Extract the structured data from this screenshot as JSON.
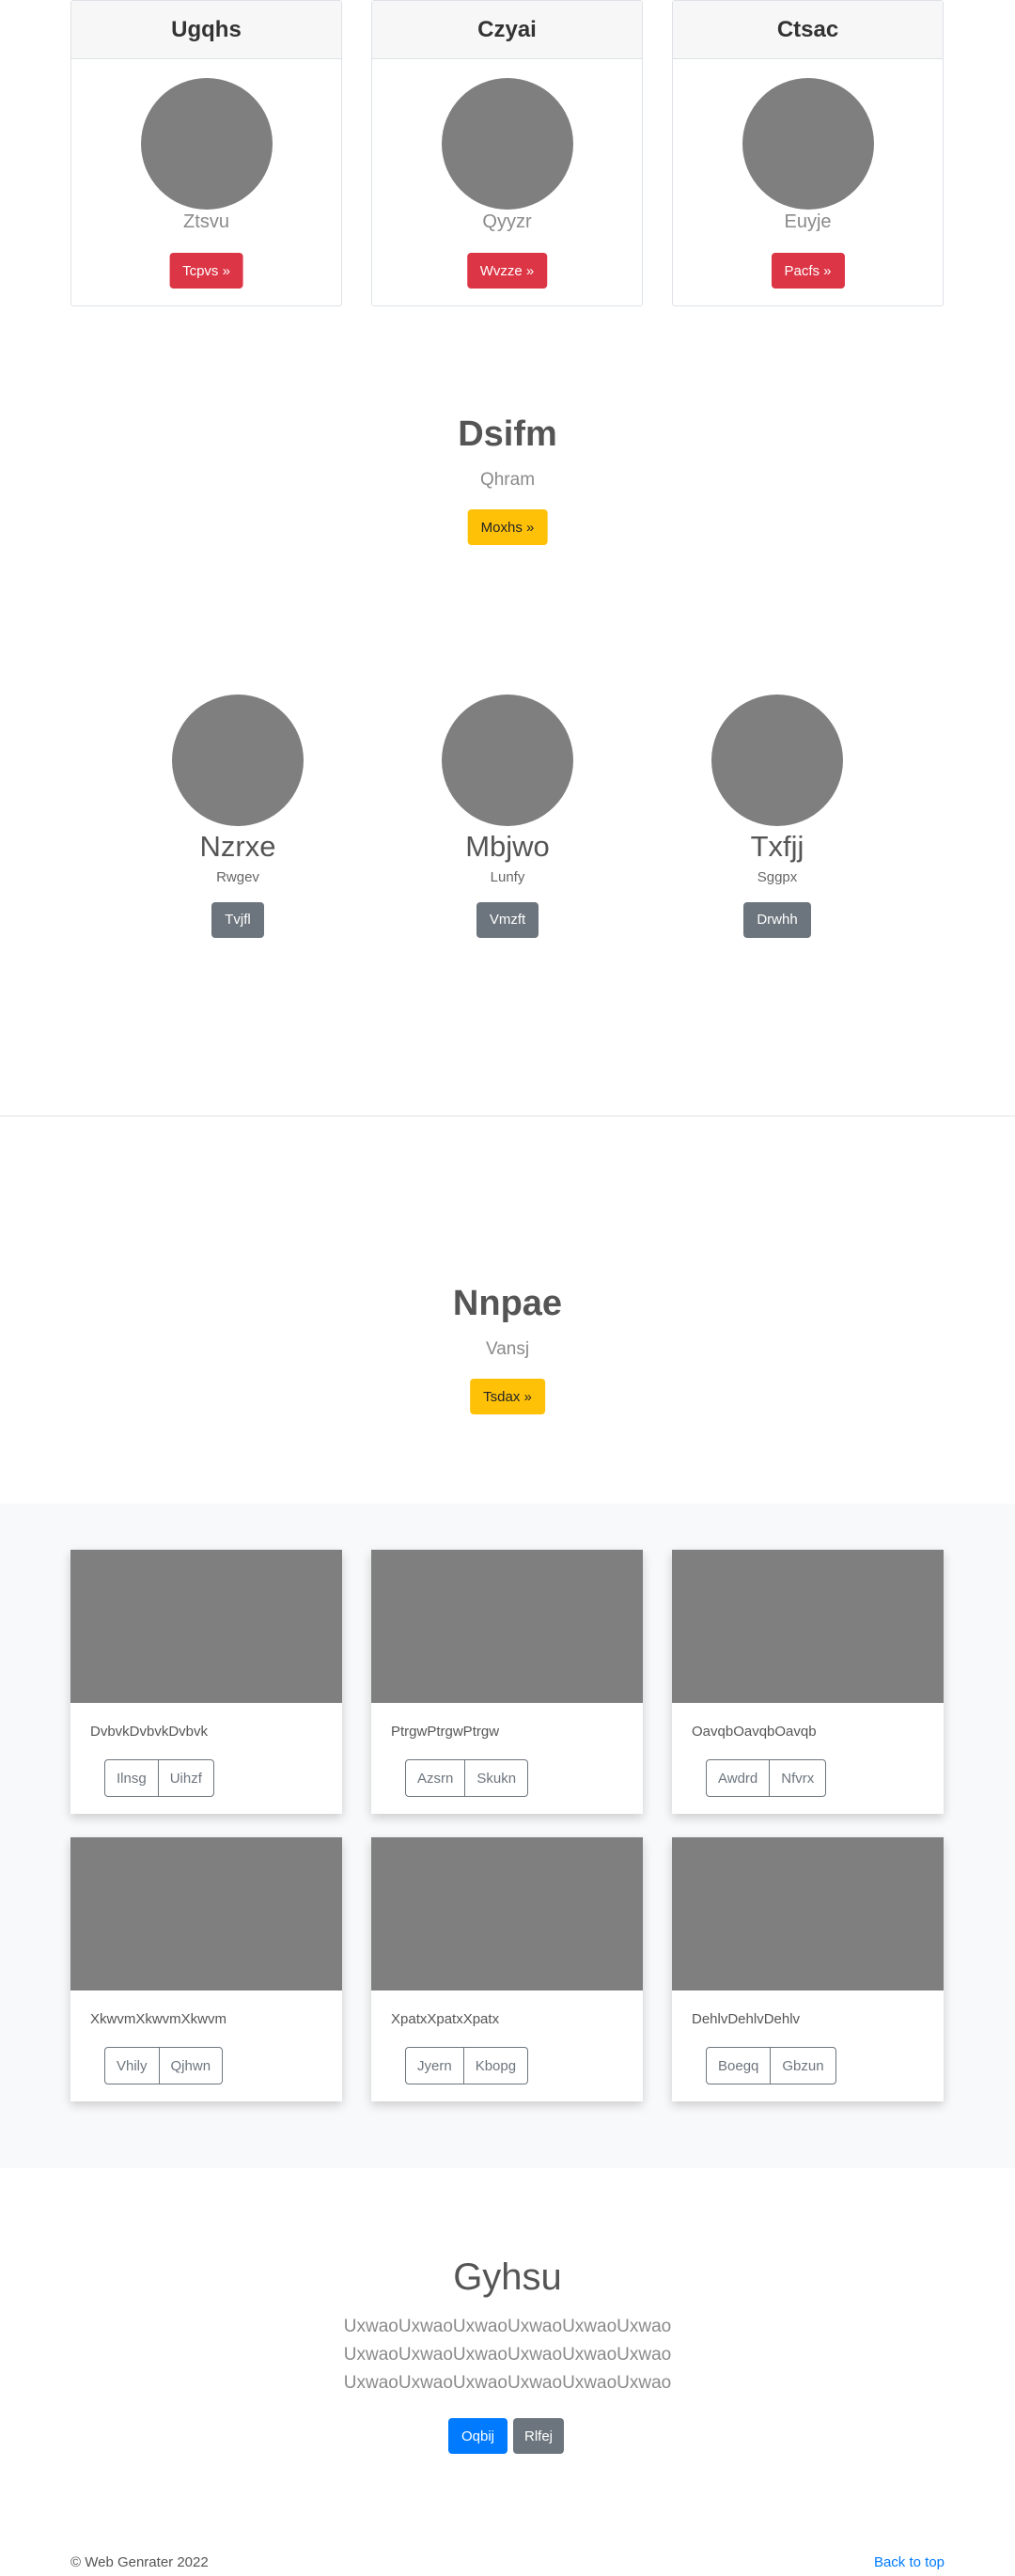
{
  "pricing_cards": [
    {
      "title": "Ugqhs",
      "subtitle": "Ztsvu",
      "button": "Tcpvs »"
    },
    {
      "title": "Czyai",
      "subtitle": "Qyyzr",
      "button": "Wvzze »"
    },
    {
      "title": "Ctsac",
      "subtitle": "Euyje",
      "button": "Pacfs »"
    }
  ],
  "hero1": {
    "title": "Dsifm",
    "subtitle": "Qhram",
    "button": "Moxhs »"
  },
  "team": [
    {
      "name": "Nzrxe",
      "role": "Rwgev",
      "button": "Tvjfl"
    },
    {
      "name": "Mbjwo",
      "role": "Lunfy",
      "button": "Vmzft"
    },
    {
      "name": "Txfjj",
      "role": "Sggpx",
      "button": "Drwhh"
    }
  ],
  "hero2": {
    "title": "Nnpae",
    "subtitle": "Vansj",
    "button": "Tsdax »"
  },
  "album": [
    {
      "text": "DvbvkDvbvkDvbvk",
      "btn1": "Ilnsg",
      "btn2": "Uihzf"
    },
    {
      "text": "PtrgwPtrgwPtrgw",
      "btn1": "Azsrn",
      "btn2": "Skukn"
    },
    {
      "text": "OavqbOavqbOavqb",
      "btn1": "Awdrd",
      "btn2": "Nfvrx"
    },
    {
      "text": "XkwvmXkwvmXkwvm",
      "btn1": "Vhily",
      "btn2": "Qjhwn"
    },
    {
      "text": "XpatxXpatxXpatx",
      "btn1": "Jyern",
      "btn2": "Kbopg"
    },
    {
      "text": "DehlvDehlvDehlv",
      "btn1": "Boegq",
      "btn2": "Gbzun"
    }
  ],
  "jumbotron": {
    "title": "Gyhsu",
    "lines": [
      "UxwaoUxwaoUxwaoUxwaoUxwaoUxwao",
      "UxwaoUxwaoUxwaoUxwaoUxwaoUxwao",
      "UxwaoUxwaoUxwaoUxwaoUxwaoUxwao"
    ],
    "primary_button": "Oqbij",
    "secondary_button": "Rlfej"
  },
  "footer": {
    "copyright": "© Web Genrater 2022",
    "back_to_top": "Back to top"
  },
  "colors": {
    "danger": "#dc3545",
    "warning": "#ffc107",
    "primary": "#007bff",
    "secondary": "#6c757d",
    "placeholder": "#7f7f7f"
  }
}
